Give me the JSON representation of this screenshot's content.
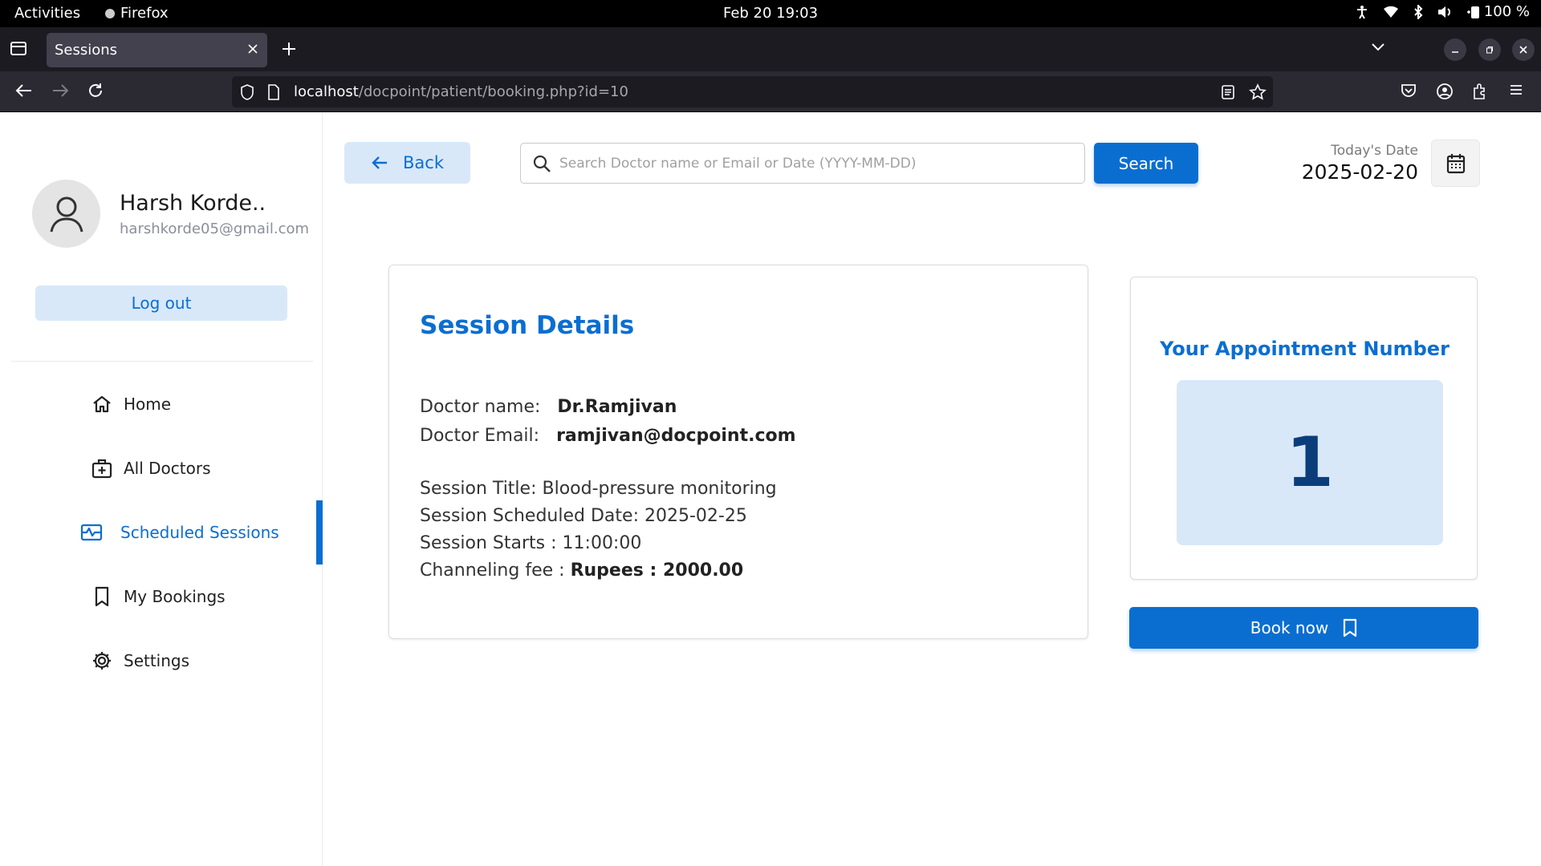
{
  "system_bar": {
    "activities": "Activities",
    "app_name": "Firefox",
    "clock": "Feb 20  19:03",
    "battery": "100 %"
  },
  "browser": {
    "tab_title": "Sessions",
    "url_host": "localhost",
    "url_path": "/docpoint/patient/booking.php?id=10"
  },
  "sidebar": {
    "user_name": "Harsh Korde..",
    "user_email": "harshkorde05@gmail.com",
    "logout_label": "Log out",
    "items": [
      {
        "label": "Home",
        "icon": "home-icon"
      },
      {
        "label": "All Doctors",
        "icon": "medical-kit-icon"
      },
      {
        "label": "Scheduled Sessions",
        "icon": "sessions-icon",
        "active": true
      },
      {
        "label": "My Bookings",
        "icon": "bookmark-icon"
      },
      {
        "label": "Settings",
        "icon": "gear-icon"
      }
    ]
  },
  "header": {
    "back_label": "Back",
    "search_placeholder": "Search Doctor name or Email or Date (YYYY-MM-DD)",
    "search_button": "Search",
    "date_label": "Today's Date",
    "date_value": "2025-02-20"
  },
  "session": {
    "title": "Session Details",
    "doctor_name_label": "Doctor name:",
    "doctor_name": "Dr.Ramjivan",
    "doctor_email_label": "Doctor Email:",
    "doctor_email": "ramjivan@docpoint.com",
    "session_title": "Session Title: Blood-pressure monitoring",
    "session_date": "Session Scheduled Date: 2025-02-25",
    "session_starts": "Session Starts : 11:00:00",
    "fee_label": "Channeling fee : ",
    "fee_value": "Rupees : 2000.00"
  },
  "appointment": {
    "title": "Your Appointment Number",
    "number": "1",
    "book_label": "Book now"
  },
  "colors": {
    "accent": "#0a6ed1",
    "accent_light": "#d8e8f9"
  }
}
